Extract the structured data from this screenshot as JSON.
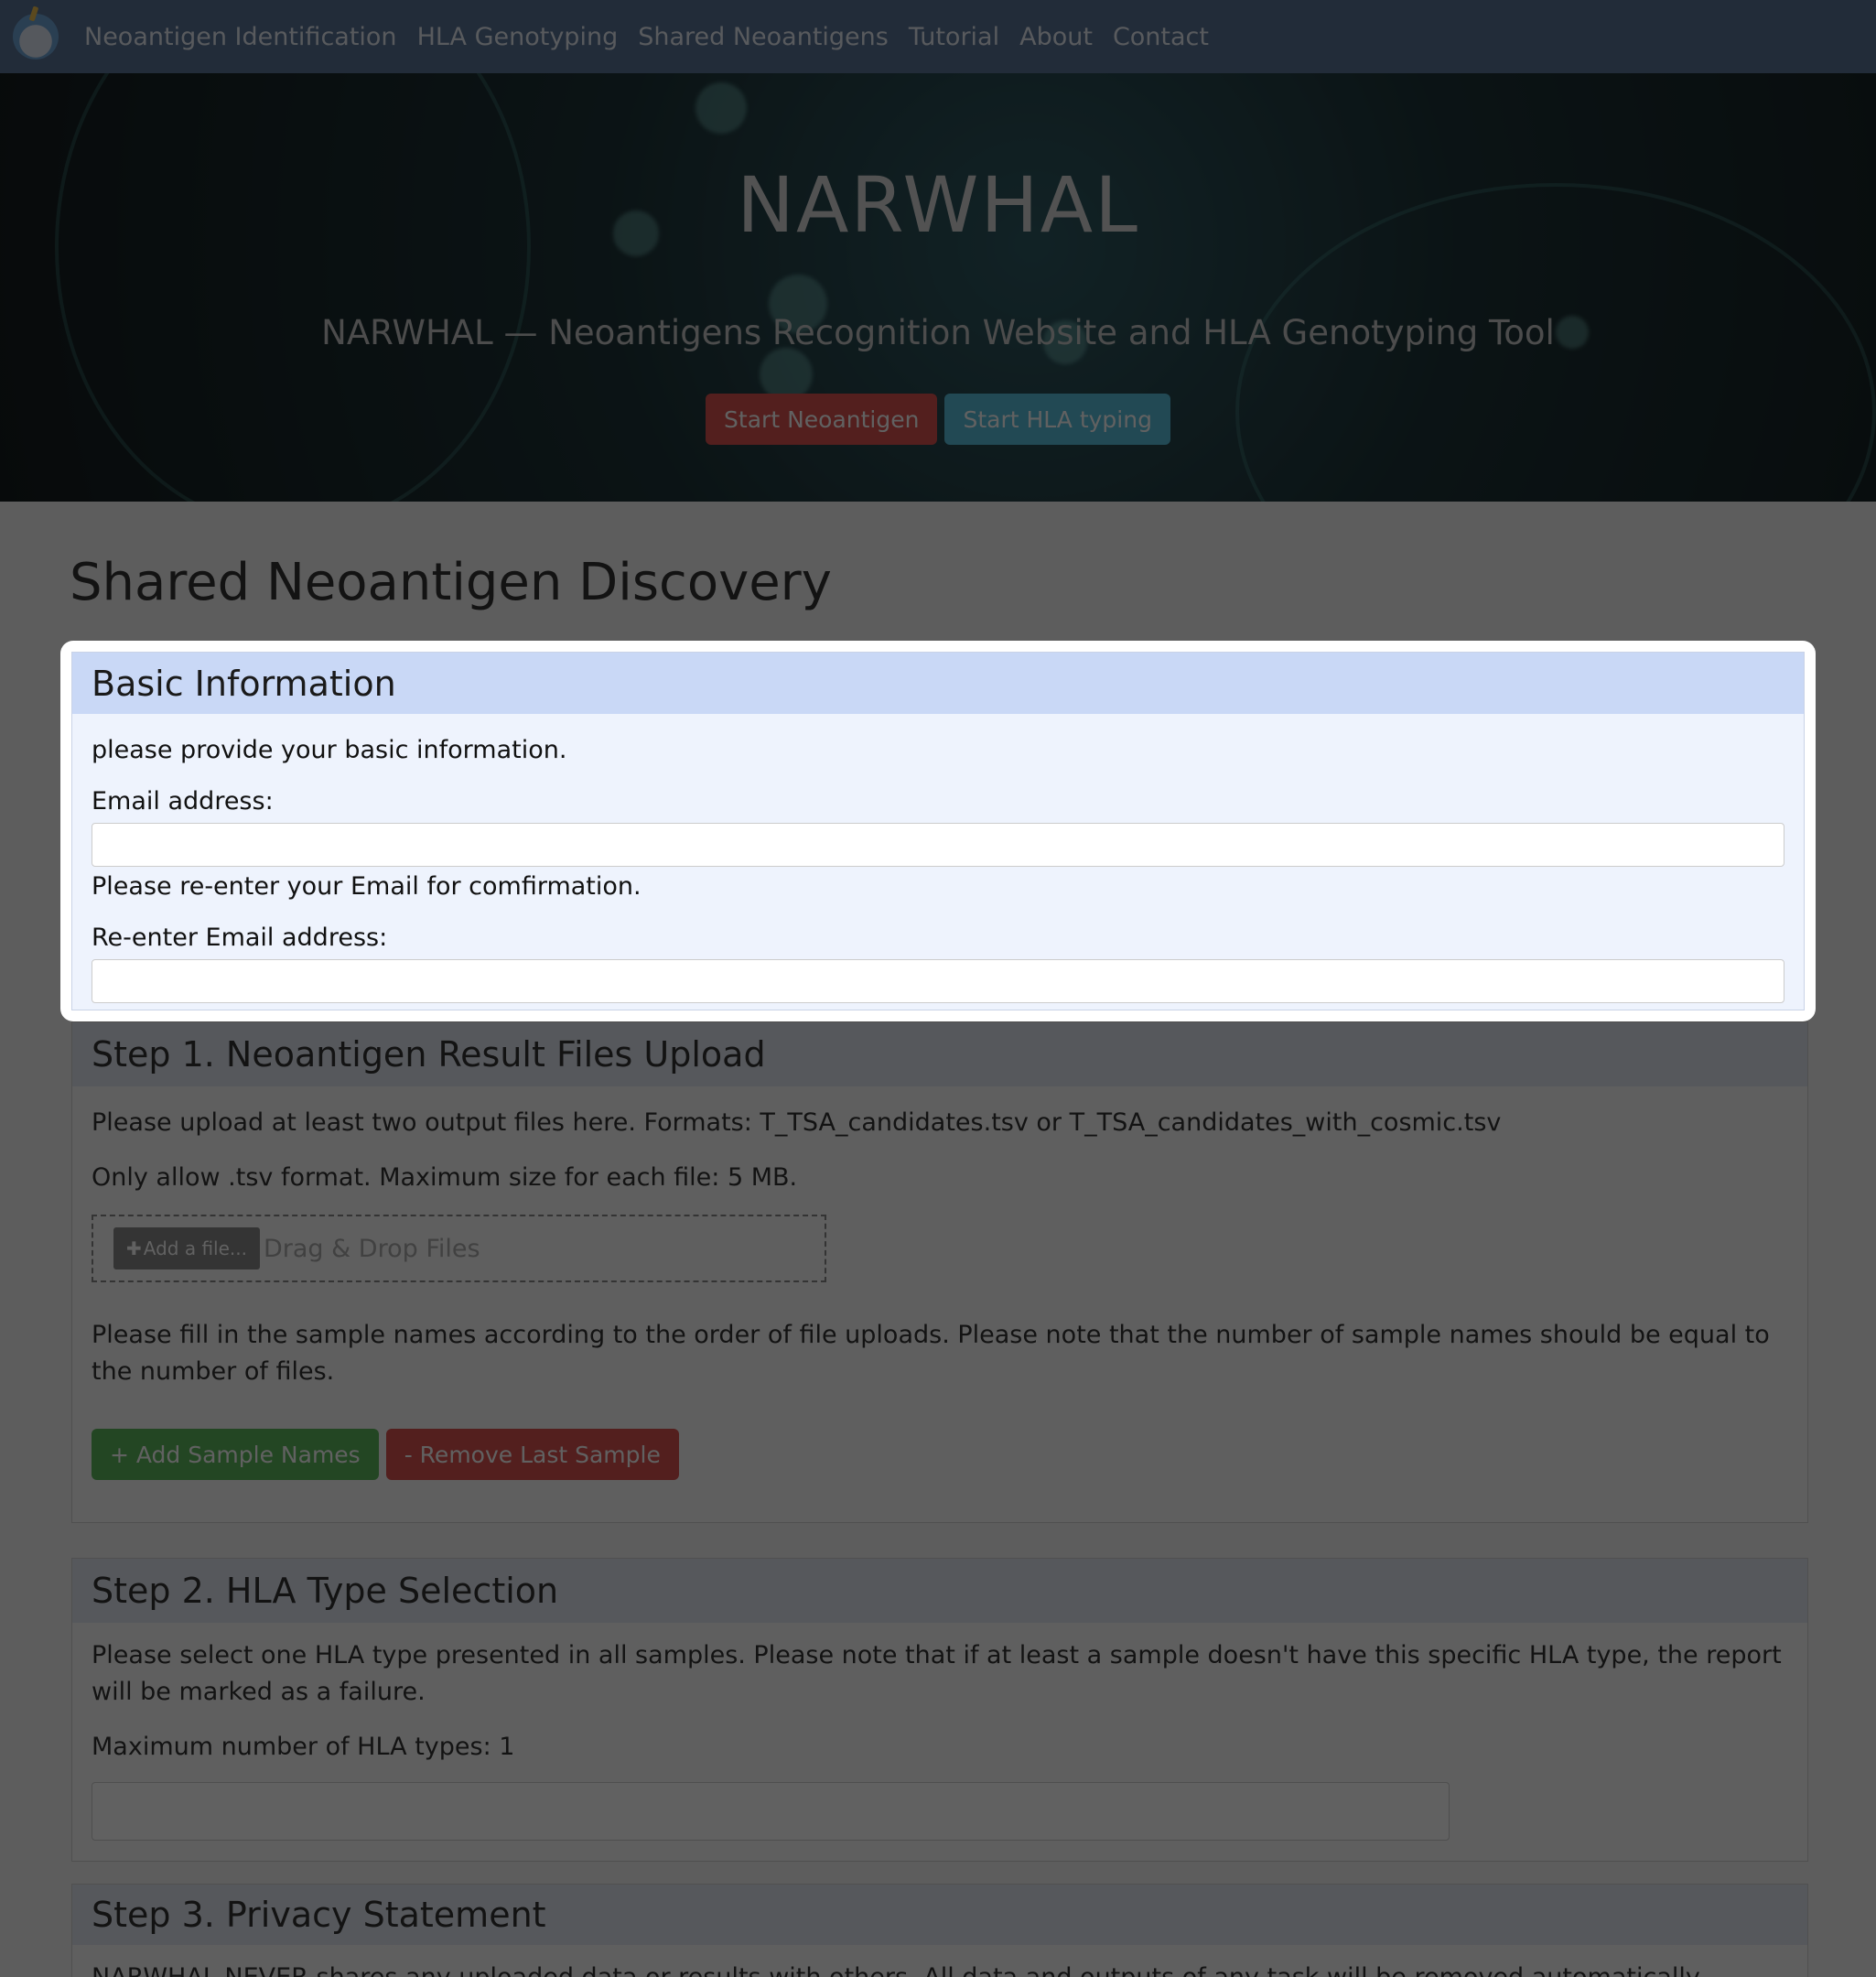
{
  "nav": {
    "items": [
      "Neoantigen Identification",
      "HLA Genotyping",
      "Shared Neoantigens",
      "Tutorial",
      "About",
      "Contact"
    ]
  },
  "hero": {
    "title": "NARWHAL",
    "subtitle": "NARWHAL — Neoantigens Recognition Website and HLA Genotyping Tool",
    "btn_neoantigen": "Start Neoantigen",
    "btn_hla": "Start HLA typing"
  },
  "page_title": "Shared Neoantigen Discovery",
  "basic_info": {
    "header": "Basic Information",
    "intro": "please provide your basic information.",
    "email_label": "Email address:",
    "reenter_note": "Please re-enter your Email for comfirmation.",
    "reenter_label": "Re-enter Email address:"
  },
  "step1": {
    "header": "Step 1. Neoantigen Result Files Upload",
    "upload_note": "Please upload at least two output files here. Formats: T_TSA_candidates.tsv or T_TSA_candidates_with_cosmic.tsv",
    "format_note": "Only allow .tsv format. Maximum size for each file: 5 MB.",
    "add_file": "Add a file...",
    "dropzone_text": "Drag & Drop Files",
    "sample_note": "Please fill in the sample names according to the order of file uploads. Please note that the number of sample names should be equal to the number of files.",
    "add_sample": "+ Add Sample Names",
    "remove_sample": "- Remove Last Sample"
  },
  "step2": {
    "header": "Step 2. HLA Type Selection",
    "note": "Please select one HLA type presented in all samples. Please note that if at least a sample doesn't have this specific HLA type, the report will be marked as a failure.",
    "max_note": "Maximum number of HLA types: 1"
  },
  "step3": {
    "header": "Step 3. Privacy Statement",
    "text": "NARWHAL NEVER shares any uploaded data or results with others. All data and outputs of any task will be removed automatically..."
  },
  "colors": {
    "nav_bg": "#5a7396",
    "btn_red": "#d9534f",
    "btn_cyan": "#5bc0de",
    "btn_green": "#5cb85c",
    "highlight_header": "#c9d8f6"
  }
}
